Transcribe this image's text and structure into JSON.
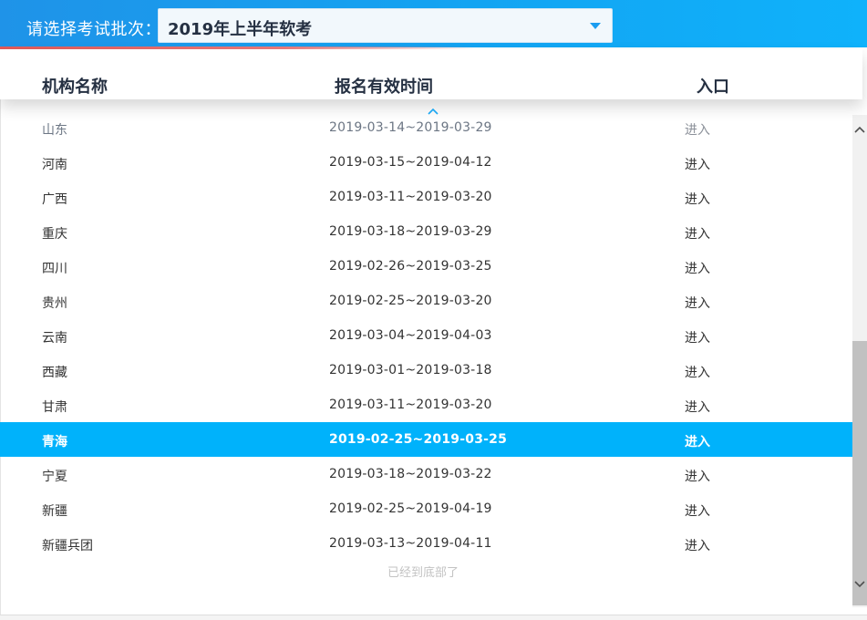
{
  "header": {
    "batch_label": "请选择考试批次：",
    "selected_batch": "2019年上半年软考"
  },
  "table": {
    "columns": [
      "机构名称",
      "报名有效时间",
      "入口"
    ],
    "rows": [
      {
        "name": "山东",
        "period": "2019-03-14~2019-03-29",
        "entry": "进入"
      },
      {
        "name": "河南",
        "period": "2019-03-15~2019-04-12",
        "entry": "进入"
      },
      {
        "name": "广西",
        "period": "2019-03-11~2019-03-20",
        "entry": "进入"
      },
      {
        "name": "重庆",
        "period": "2019-03-18~2019-03-29",
        "entry": "进入"
      },
      {
        "name": "四川",
        "period": "2019-02-26~2019-03-25",
        "entry": "进入"
      },
      {
        "name": "贵州",
        "period": "2019-02-25~2019-03-20",
        "entry": "进入"
      },
      {
        "name": "云南",
        "period": "2019-03-04~2019-04-03",
        "entry": "进入"
      },
      {
        "name": "西藏",
        "period": "2019-03-01~2019-03-18",
        "entry": "进入"
      },
      {
        "name": "甘肃",
        "period": "2019-03-11~2019-03-20",
        "entry": "进入"
      },
      {
        "name": "青海",
        "period": "2019-02-25~2019-03-25",
        "entry": "进入"
      },
      {
        "name": "宁夏",
        "period": "2019-03-18~2019-03-22",
        "entry": "进入"
      },
      {
        "name": "新疆",
        "period": "2019-02-25~2019-04-19",
        "entry": "进入"
      },
      {
        "name": "新疆兵团",
        "period": "2019-03-13~2019-04-11",
        "entry": "进入"
      }
    ],
    "selected_row": "青海",
    "bottom_tip": "已经到底部了"
  },
  "icons": {
    "dropdown": "chevron-down-icon",
    "scroll_up_hint": "chevron-up-icon",
    "scrollbar_up": "scroll-up-arrow-icon",
    "scrollbar_down": "scroll-down-arrow-icon"
  },
  "colors": {
    "header_blue": "#13a4f2",
    "header_red_line": "#e35a5a",
    "selected_row": "#00b2fb",
    "text_dark": "#253042"
  }
}
